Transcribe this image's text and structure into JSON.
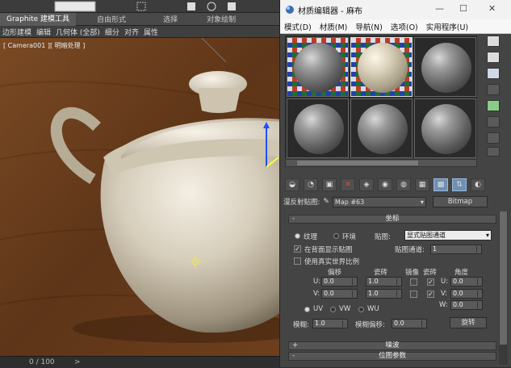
{
  "max": {
    "ribbon_tabs": [
      "Graphite 建模工具",
      "自由形式",
      "选择",
      "对象绘制"
    ],
    "ribbon_items": [
      "边形建模",
      "编辑",
      "几何体 (全部)",
      "细分",
      "对齐",
      "属性"
    ],
    "viewport_label": "[ Camera001 ][ 明暗处理 ]",
    "status_progress": "0 / 100",
    "scroll_arrow": ">"
  },
  "editor": {
    "title": "材质编辑器 - 麻布",
    "menu": [
      "模式(D)",
      "材质(M)",
      "导航(N)",
      "选项(O)",
      "实用程序(U)"
    ],
    "map_label": "漫反射贴图:",
    "map_name": "Map #63",
    "map_type": "Bitmap",
    "rollouts": {
      "coords": "坐标",
      "noise": "噪波",
      "bitmap": "位图参数"
    },
    "coords": {
      "texture": "纹理",
      "environ": "环境",
      "mapping_label": "贴图:",
      "mapping_value": "显式贴图通道",
      "show_on_back": "在背面显示贴图",
      "channel_label": "贴图通道:",
      "channel_value": "1",
      "real_world": "使用真实世界比例",
      "offset": "偏移",
      "tiling": "瓷砖",
      "mirror": "镜像",
      "tile": "瓷砖",
      "angle": "角度",
      "u": "U:",
      "v": "V:",
      "w": "W:",
      "u_offset": "0.0",
      "v_offset": "0.0",
      "u_tiling": "1.0",
      "v_tiling": "1.0",
      "u_angle": "0.0",
      "v_angle": "0.0",
      "w_angle": "0.0",
      "uv": "UV",
      "vw": "VW",
      "wu": "WU",
      "blur_label": "模糊:",
      "blur_value": "1.0",
      "blur_offset_label": "模糊偏移:",
      "blur_offset_value": "0.0",
      "rotate": "旋转",
      "check": "✓"
    }
  }
}
